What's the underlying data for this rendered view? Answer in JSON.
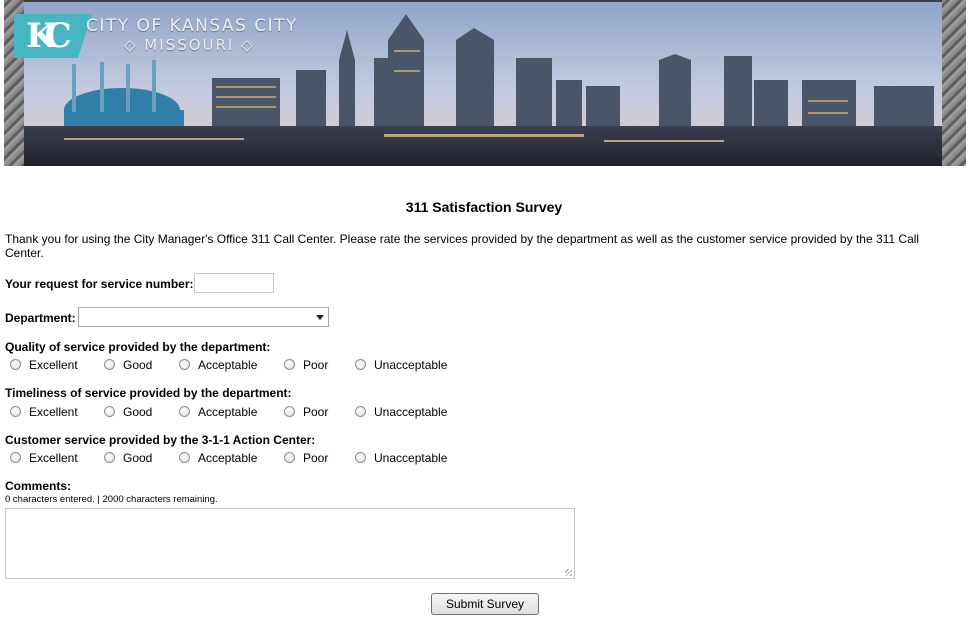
{
  "header": {
    "city_name": "CITY OF KANSAS CITY",
    "state_name": "◇ MISSOURI ◇",
    "logo_letters": "KC",
    "colors": {
      "logo_teal": "#46b6c3",
      "sky_top": "#8aa0c4",
      "sky_bottom": "#d9c9c5"
    }
  },
  "survey": {
    "title": "311 Satisfaction Survey",
    "intro": "Thank you for using the City Manager's Office 311 Call Center. Please rate the services provided by the department as well as the customer service provided by the 311 Call Center.",
    "request_label": "Your request for service number:",
    "request_value": "",
    "department_label": "Department:",
    "department_selected": "",
    "rating_options": [
      "Excellent",
      "Good",
      "Acceptable",
      "Poor",
      "Unacceptable"
    ],
    "questions": [
      {
        "label": "Quality of service provided by the department:"
      },
      {
        "label": "Timeliness of service provided by the department:"
      },
      {
        "label": "Customer service provided by the 3-1-1 Action Center:"
      }
    ],
    "comments_label": "Comments:",
    "counter_text": "0 characters entered. | 2000 characters remaining.",
    "comments_value": "",
    "submit_label": "Submit Survey"
  }
}
